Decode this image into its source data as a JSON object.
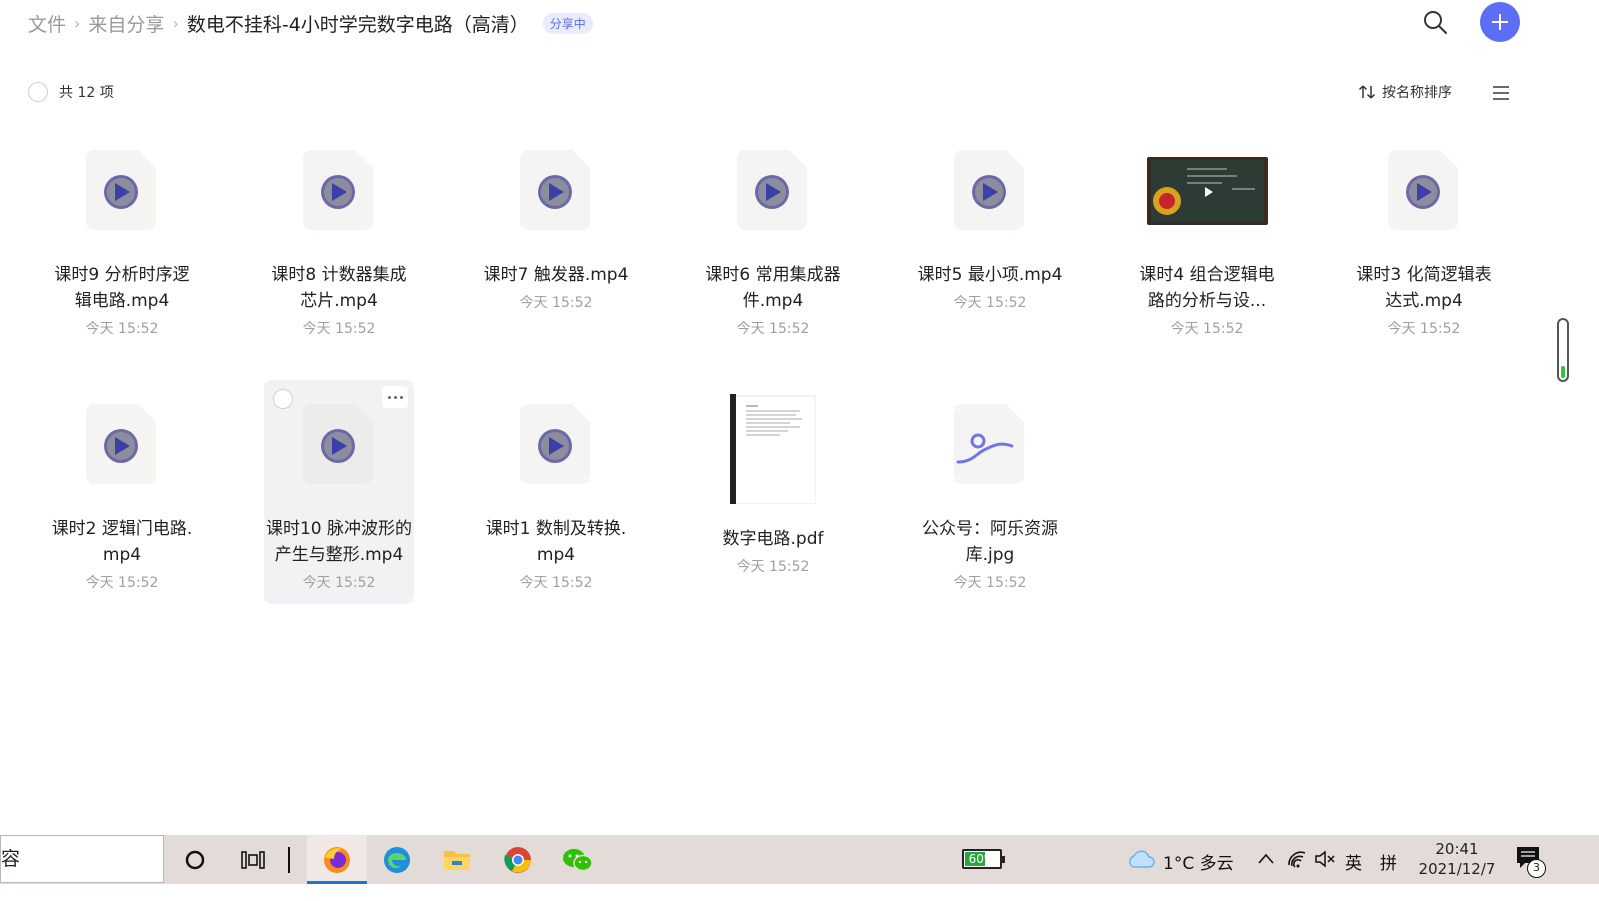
{
  "breadcrumb": {
    "items": [
      "文件",
      "来自分享"
    ],
    "current": "数电不挂科-4小时学完数字电路（高清）",
    "badge": "分享中"
  },
  "toolbar": {
    "count_label": "共 12 项",
    "sort_label": "按名称排序"
  },
  "files": [
    {
      "name": "课时9 分析时序逻辑电路.mp4",
      "time": "今天 15:52",
      "kind": "video"
    },
    {
      "name": "课时8 计数器集成芯片.mp4",
      "time": "今天 15:52",
      "kind": "video"
    },
    {
      "name": "课时7 触发器.mp4",
      "time": "今天 15:52",
      "kind": "video"
    },
    {
      "name": "课时6 常用集成器件.mp4",
      "time": "今天 15:52",
      "kind": "video"
    },
    {
      "name": "课时5 最小项.mp4",
      "time": "今天 15:52",
      "kind": "video"
    },
    {
      "name": "课时4 组合逻辑电路的分析与设...",
      "time": "今天 15:52",
      "kind": "video-thumb"
    },
    {
      "name": "课时3 化简逻辑表达式.mp4",
      "time": "今天 15:52",
      "kind": "video"
    },
    {
      "name": "课时2 逻辑门电路.mp4",
      "time": "今天 15:52",
      "kind": "video"
    },
    {
      "name": "课时10 脉冲波形的产生与整形.mp4",
      "time": "今天 15:52",
      "kind": "video"
    },
    {
      "name": "课时1 数制及转换.mp4",
      "time": "今天 15:52",
      "kind": "video"
    },
    {
      "name": "数字电路.pdf",
      "time": "今天 15:52",
      "kind": "pdf"
    },
    {
      "name": "公众号：阿乐资源库.jpg",
      "time": "今天 15:52",
      "kind": "image"
    }
  ],
  "taskbar": {
    "search_text": "容",
    "battery_percent": 60,
    "battery_label": "60%",
    "weather": "1°C  多云",
    "ime_lang": "英",
    "ime_mode": "拼",
    "time": "20:41",
    "date": "2021/12/7",
    "notification_count": "3"
  },
  "colors": {
    "accent": "#5b6ef5",
    "badge_bg": "#e9ecff",
    "taskbar_bg": "#e2dbd7",
    "active_indicator": "#0f7ad8"
  }
}
